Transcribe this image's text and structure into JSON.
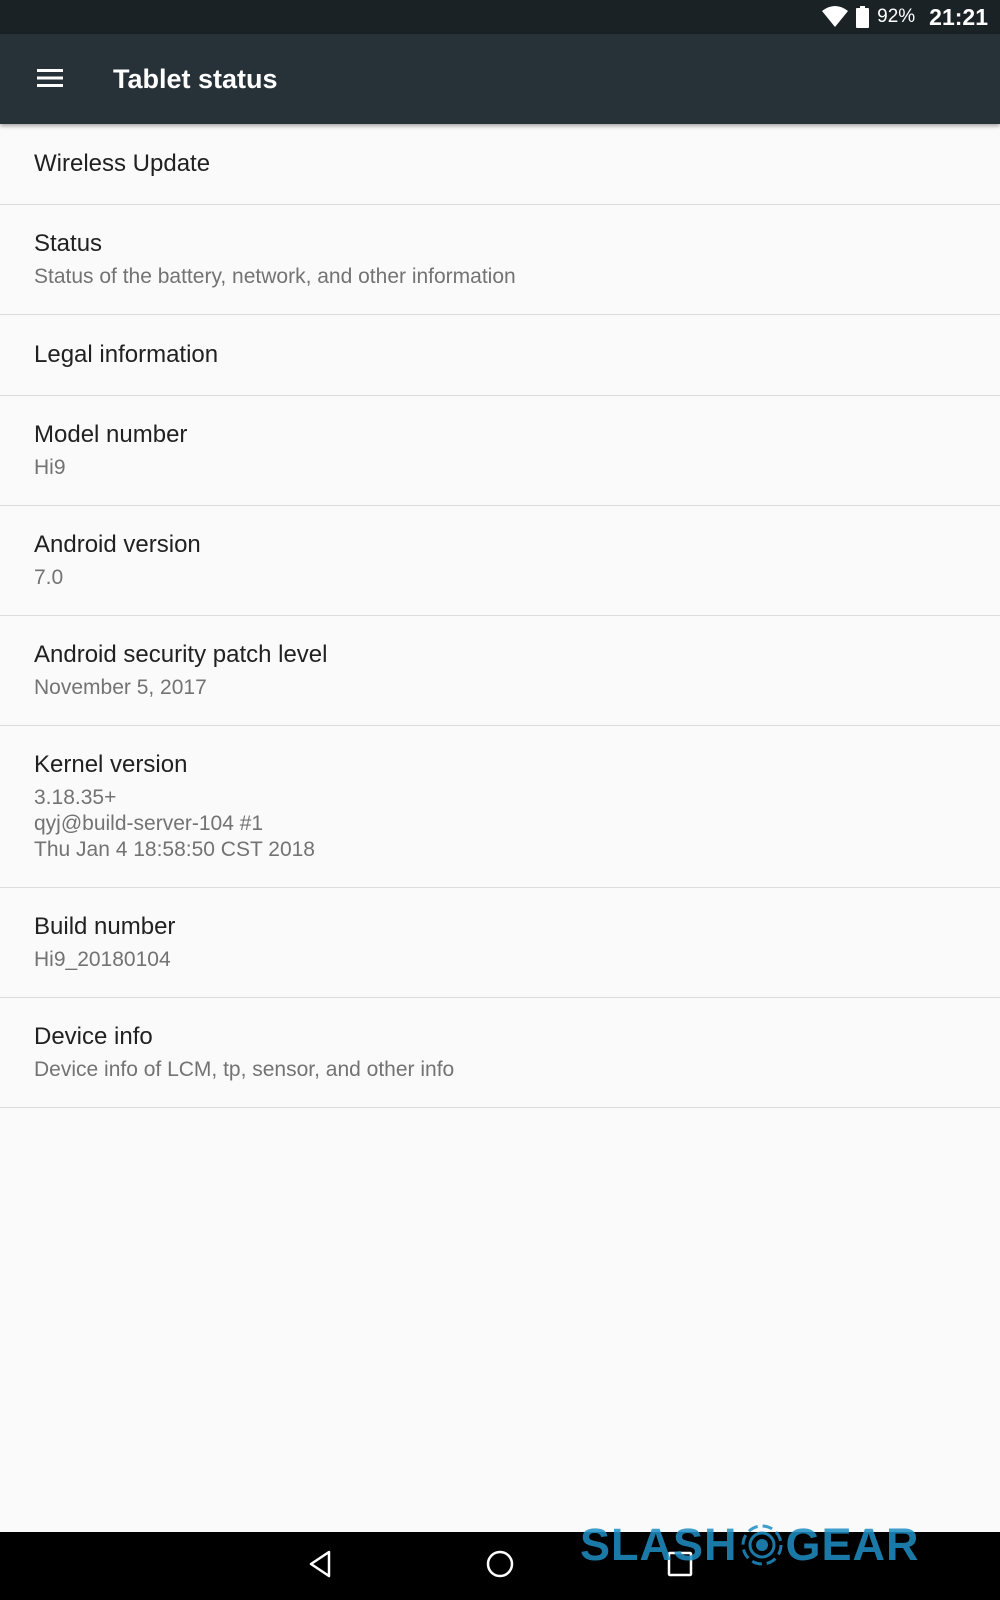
{
  "status_bar": {
    "battery_percent": "92%",
    "time": "21:21",
    "wifi_icon": "wifi-icon",
    "battery_icon": "battery-icon"
  },
  "app_bar": {
    "title": "Tablet status",
    "menu_icon": "menu-icon"
  },
  "items": [
    {
      "title": "Wireless Update",
      "summary": ""
    },
    {
      "title": "Status",
      "summary": "Status of the battery, network, and other information"
    },
    {
      "title": "Legal information",
      "summary": ""
    },
    {
      "title": "Model number",
      "summary": "Hi9"
    },
    {
      "title": "Android version",
      "summary": "7.0"
    },
    {
      "title": "Android security patch level",
      "summary": "November 5, 2017"
    },
    {
      "title": "Kernel version",
      "summary": "3.18.35+\nqyj@build-server-104 #1\nThu Jan 4 18:58:50 CST 2018"
    },
    {
      "title": "Build number",
      "summary": "Hi9_20180104"
    },
    {
      "title": "Device info",
      "summary": "Device info of LCM, tp, sensor, and other info"
    }
  ],
  "nav_bar": {
    "back_icon": "back-icon",
    "home_icon": "home-icon",
    "recents_icon": "recents-icon"
  },
  "watermark": {
    "left_text": "SLASH",
    "right_text": "GEAR"
  },
  "colors": {
    "status_bar": "#1a2226",
    "app_bar": "#263238",
    "background": "#fafafa",
    "title_text": "#212121",
    "summary_text": "#737373",
    "divider": "#dcdcdc",
    "watermark": "#1f8fc4"
  }
}
